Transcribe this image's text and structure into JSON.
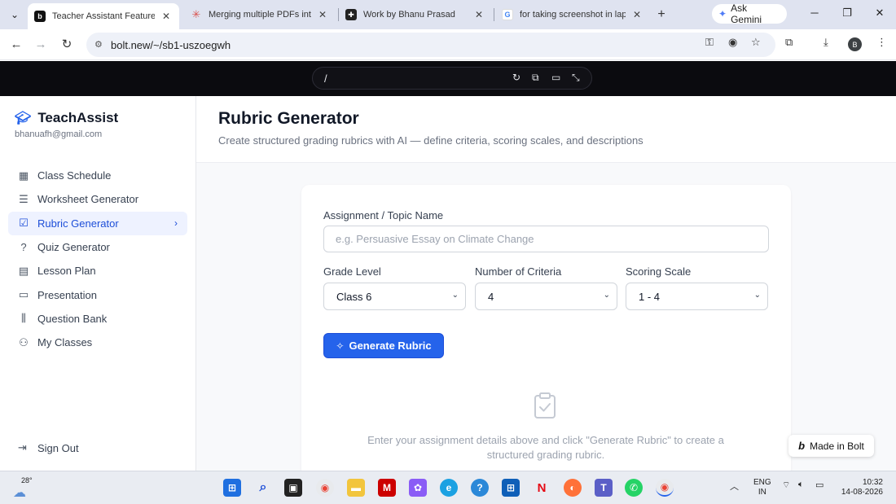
{
  "browser": {
    "tabs": [
      {
        "title": "Teacher Assistant Feature Su",
        "favicon": "bolt-b-icon",
        "active": true
      },
      {
        "title": "Merging multiple PDFs into",
        "favicon": "asterisk-icon",
        "active": false
      },
      {
        "title": "Work by Bhanu Prasad",
        "favicon": "work-icon",
        "active": false
      },
      {
        "title": "for taking screenshot in lapt",
        "favicon": "google-icon",
        "active": false
      }
    ],
    "ask_gemini": "Ask Gemini",
    "url": "bolt.new/~/sb1-uszoegwh",
    "profile_initial": "B"
  },
  "preview": {
    "path": "/"
  },
  "sidebar": {
    "brand": "TeachAssist",
    "email": "bhanuafh@gmail.com",
    "items": [
      {
        "label": "Class Schedule",
        "icon": "calendar-icon"
      },
      {
        "label": "Worksheet Generator",
        "icon": "clipboard-list-icon"
      },
      {
        "label": "Rubric Generator",
        "icon": "clipboard-check-icon",
        "active": true
      },
      {
        "label": "Quiz Generator",
        "icon": "help-circle-icon"
      },
      {
        "label": "Lesson Plan",
        "icon": "file-text-icon"
      },
      {
        "label": "Presentation",
        "icon": "presentation-icon"
      },
      {
        "label": "Question Bank",
        "icon": "library-icon"
      },
      {
        "label": "My Classes",
        "icon": "users-icon"
      }
    ],
    "sign_out": "Sign Out"
  },
  "page": {
    "title": "Rubric Generator",
    "subtitle": "Create structured grading rubrics with AI — define criteria, scoring scales, and descriptions"
  },
  "form": {
    "topic_label": "Assignment / Topic Name",
    "topic_placeholder": "e.g. Persuasive Essay on Climate Change",
    "topic_value": "",
    "grade_label": "Grade Level",
    "grade_value": "Class 6",
    "criteria_label": "Number of Criteria",
    "criteria_value": "4",
    "scale_label": "Scoring Scale",
    "scale_value": "1 - 4",
    "generate_label": "Generate Rubric"
  },
  "empty_state": {
    "text": "Enter your assignment details above and click \"Generate Rubric\" to create a structured grading rubric."
  },
  "bolt_badge": "Made in Bolt",
  "taskbar": {
    "temperature": "28°",
    "lang_line1": "ENG",
    "lang_line2": "IN",
    "time": "10:32",
    "date": "14-08-2026"
  }
}
